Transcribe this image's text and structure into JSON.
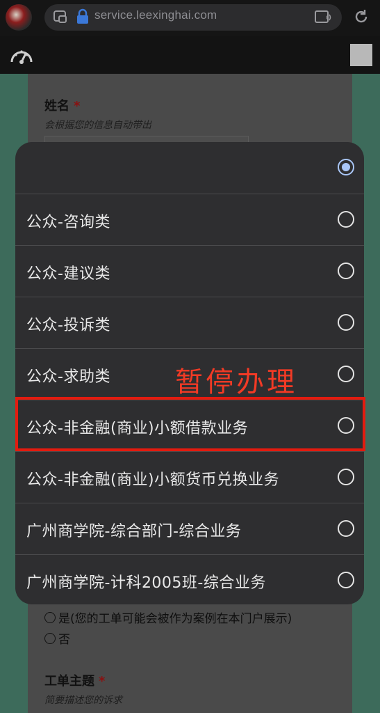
{
  "browser": {
    "url": "service.leexinghai.com"
  },
  "form": {
    "cut_label": "…",
    "name_label": "姓名",
    "required_mark": "*",
    "name_hint": "会根据您的信息自动带出",
    "public_yes": "是(您的工单可能会被作为案例在本门户展示)",
    "public_no": "否",
    "subject_label": "工单主题",
    "subject_hint": "简要描述您的诉求"
  },
  "dialog": {
    "options": [
      {
        "label": "",
        "selected": true
      },
      {
        "label": "公众-咨询类",
        "selected": false
      },
      {
        "label": "公众-建议类",
        "selected": false
      },
      {
        "label": "公众-投诉类",
        "selected": false
      },
      {
        "label": "公众-求助类",
        "selected": false
      },
      {
        "label": "公众-非金融(商业)小额借款业务",
        "selected": false
      },
      {
        "label": "公众-非金融(商业)小额货币兑换业务",
        "selected": false
      },
      {
        "label": "广州商学院-综合部门-综合业务",
        "selected": false
      },
      {
        "label": "广州商学院-计科2005班-综合业务",
        "selected": false
      }
    ]
  },
  "annotation": {
    "text": "暂停办理",
    "color": "#f23a25"
  },
  "colors": {
    "accent_selected": "#a9c6f7",
    "highlight_border": "#e31b0f"
  }
}
